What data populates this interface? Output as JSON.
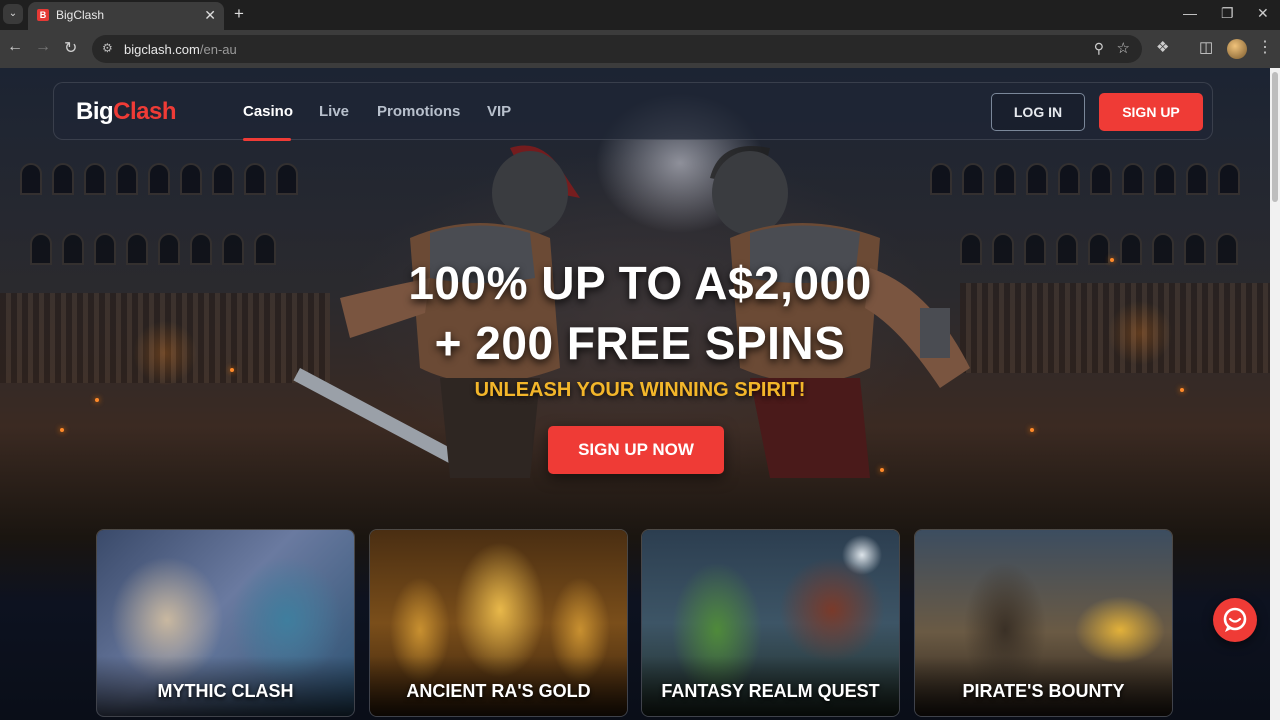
{
  "browser": {
    "tab_title": "BigClash",
    "favicon_letter": "B",
    "url_host": "bigclash.com",
    "url_path": "/en-au",
    "icons": {
      "tab_list": "chevron-down-icon",
      "close_tab": "close-icon",
      "new_tab": "plus-icon",
      "back": "back-arrow-icon",
      "forward": "forward-arrow-icon",
      "reload": "reload-icon",
      "site_info": "site-settings-icon",
      "zoom": "zoom-icon",
      "bookmark": "star-icon",
      "extensions": "puzzle-icon",
      "side_panel": "side-panel-icon",
      "menu": "kebab-menu-icon"
    }
  },
  "header": {
    "logo_big": "Big",
    "logo_clash": "Clash",
    "nav": [
      {
        "label": "Casino",
        "active": true
      },
      {
        "label": "Live",
        "active": false
      },
      {
        "label": "Promotions",
        "active": false
      },
      {
        "label": "VIP",
        "active": false
      }
    ],
    "login_label": "LOG IN",
    "signup_label": "SIGN UP"
  },
  "hero": {
    "headline_line1": "100% UP TO A$2,000",
    "headline_line2": "+ 200 FREE SPINS",
    "tagline": "UNLEASH YOUR WINNING SPIRIT!",
    "cta_label": "SIGN UP NOW"
  },
  "games": [
    {
      "title": "MYTHIC CLASH"
    },
    {
      "title": "ANCIENT RA'S GOLD"
    },
    {
      "title": "FANTASY REALM QUEST"
    },
    {
      "title": "PIRATE'S BOUNTY"
    }
  ],
  "colors": {
    "brand_red": "#ef3b36",
    "tagline_gold": "#f3b62a",
    "header_bg": "#1e2634"
  },
  "chat": {
    "icon": "chat-bubble-icon"
  }
}
